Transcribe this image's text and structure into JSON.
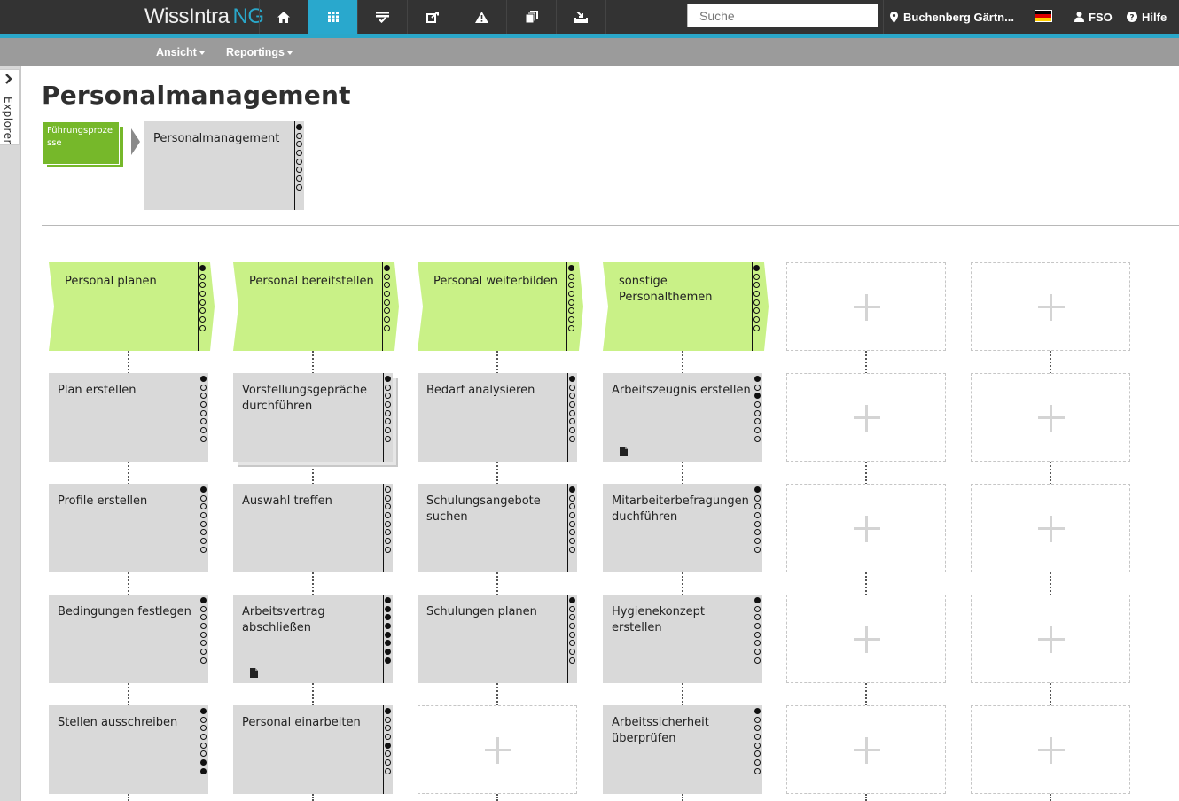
{
  "app": {
    "name": "WissIntra",
    "suffix": "NG"
  },
  "nav": {
    "icons": [
      "home-icon",
      "grid-icon",
      "checklist-icon",
      "share-icon",
      "warning-icon",
      "copy-icon",
      "inbox-icon"
    ],
    "active": "grid-icon"
  },
  "search": {
    "placeholder": "Suche",
    "value": ""
  },
  "location": {
    "label": "Buchenberg Gärtn..."
  },
  "language": {
    "flag": "de"
  },
  "user": {
    "label": "FSO"
  },
  "help": {
    "label": "Hilfe"
  },
  "menu": {
    "ansicht": "Ansicht",
    "reportings": "Reportings"
  },
  "explorer": {
    "label": "Explorer"
  },
  "page": {
    "title": "Personalmanagement"
  },
  "breadcrumb": {
    "parent": "Führungsprozesse",
    "current": "Personalmanagement",
    "current_dots": [
      1,
      0,
      0,
      0,
      0,
      0,
      0,
      0
    ]
  },
  "colors": {
    "topbar": "#333333",
    "accent": "#2aa7c9",
    "subbar": "#9b9b9b",
    "parent_green": "#76b82a",
    "head_green": "#c9f187",
    "tile_gray": "#d9d9d9"
  },
  "columns": [
    {
      "head": {
        "label": "Personal planen",
        "dots": [
          1,
          0,
          0,
          0,
          0,
          0,
          0,
          0
        ]
      },
      "items": [
        {
          "label": "Plan erstellen",
          "dots": [
            1,
            0,
            0,
            0,
            0,
            0,
            0,
            0
          ]
        },
        {
          "label": "Profile erstellen",
          "dots": [
            1,
            0,
            0,
            0,
            0,
            0,
            0,
            0
          ]
        },
        {
          "label": "Bedingungen festlegen",
          "dots": [
            1,
            0,
            0,
            0,
            0,
            0,
            0,
            0
          ]
        },
        {
          "label": "Stellen ausschreiben",
          "dots": [
            1,
            0,
            0,
            0,
            0,
            0,
            1,
            1
          ]
        }
      ]
    },
    {
      "head": {
        "label": "Personal bereitstellen",
        "dots": [
          1,
          0,
          0,
          0,
          0,
          0,
          0,
          0
        ]
      },
      "items": [
        {
          "label": "Vorstellungsgepräche durchführen",
          "dots": [
            1,
            0,
            0,
            0,
            0,
            0,
            0,
            0
          ],
          "stacked": true
        },
        {
          "label": "Auswahl treffen",
          "dots": [
            0,
            0,
            0,
            0,
            0,
            0,
            0,
            0
          ]
        },
        {
          "label": "Arbeitsvertrag abschließen",
          "dots": [
            1,
            1,
            1,
            1,
            1,
            1,
            1,
            1
          ],
          "document": true
        },
        {
          "label": "Personal einarbeiten",
          "dots": [
            1,
            0,
            0,
            0,
            1,
            0,
            0,
            0
          ]
        }
      ]
    },
    {
      "head": {
        "label": "Personal weiterbilden",
        "dots": [
          1,
          0,
          0,
          0,
          0,
          0,
          0,
          0
        ]
      },
      "items": [
        {
          "label": "Bedarf analysieren",
          "dots": [
            1,
            0,
            0,
            0,
            0,
            0,
            0,
            0
          ]
        },
        {
          "label": "Schulungsangebote suchen",
          "dots": [
            1,
            0,
            0,
            0,
            0,
            0,
            0,
            0
          ]
        },
        {
          "label": "Schulungen planen",
          "dots": [
            1,
            0,
            0,
            0,
            0,
            0,
            0,
            0
          ]
        },
        null
      ]
    },
    {
      "head": {
        "label": "sonstige Personalthemen",
        "dots": [
          1,
          0,
          0,
          0,
          0,
          0,
          0,
          0
        ]
      },
      "items": [
        {
          "label": "Arbeitszeugnis erstellen",
          "dots": [
            1,
            0,
            1,
            0,
            0,
            0,
            0,
            0
          ],
          "document": true
        },
        {
          "label": "Mitarbeiterbefragungen duchführen",
          "dots": [
            1,
            0,
            0,
            0,
            0,
            0,
            0,
            0
          ]
        },
        {
          "label": "Hygienekonzept erstellen",
          "dots": [
            1,
            0,
            0,
            0,
            0,
            0,
            0,
            0
          ]
        },
        {
          "label": "Arbeitssicherheit überprüfen",
          "dots": [
            1,
            0,
            0,
            0,
            0,
            0,
            0,
            0
          ]
        }
      ]
    },
    {
      "head": null,
      "items": [
        null,
        null,
        null,
        null
      ]
    },
    {
      "head": null,
      "items": [
        null,
        null,
        null,
        null
      ]
    }
  ]
}
